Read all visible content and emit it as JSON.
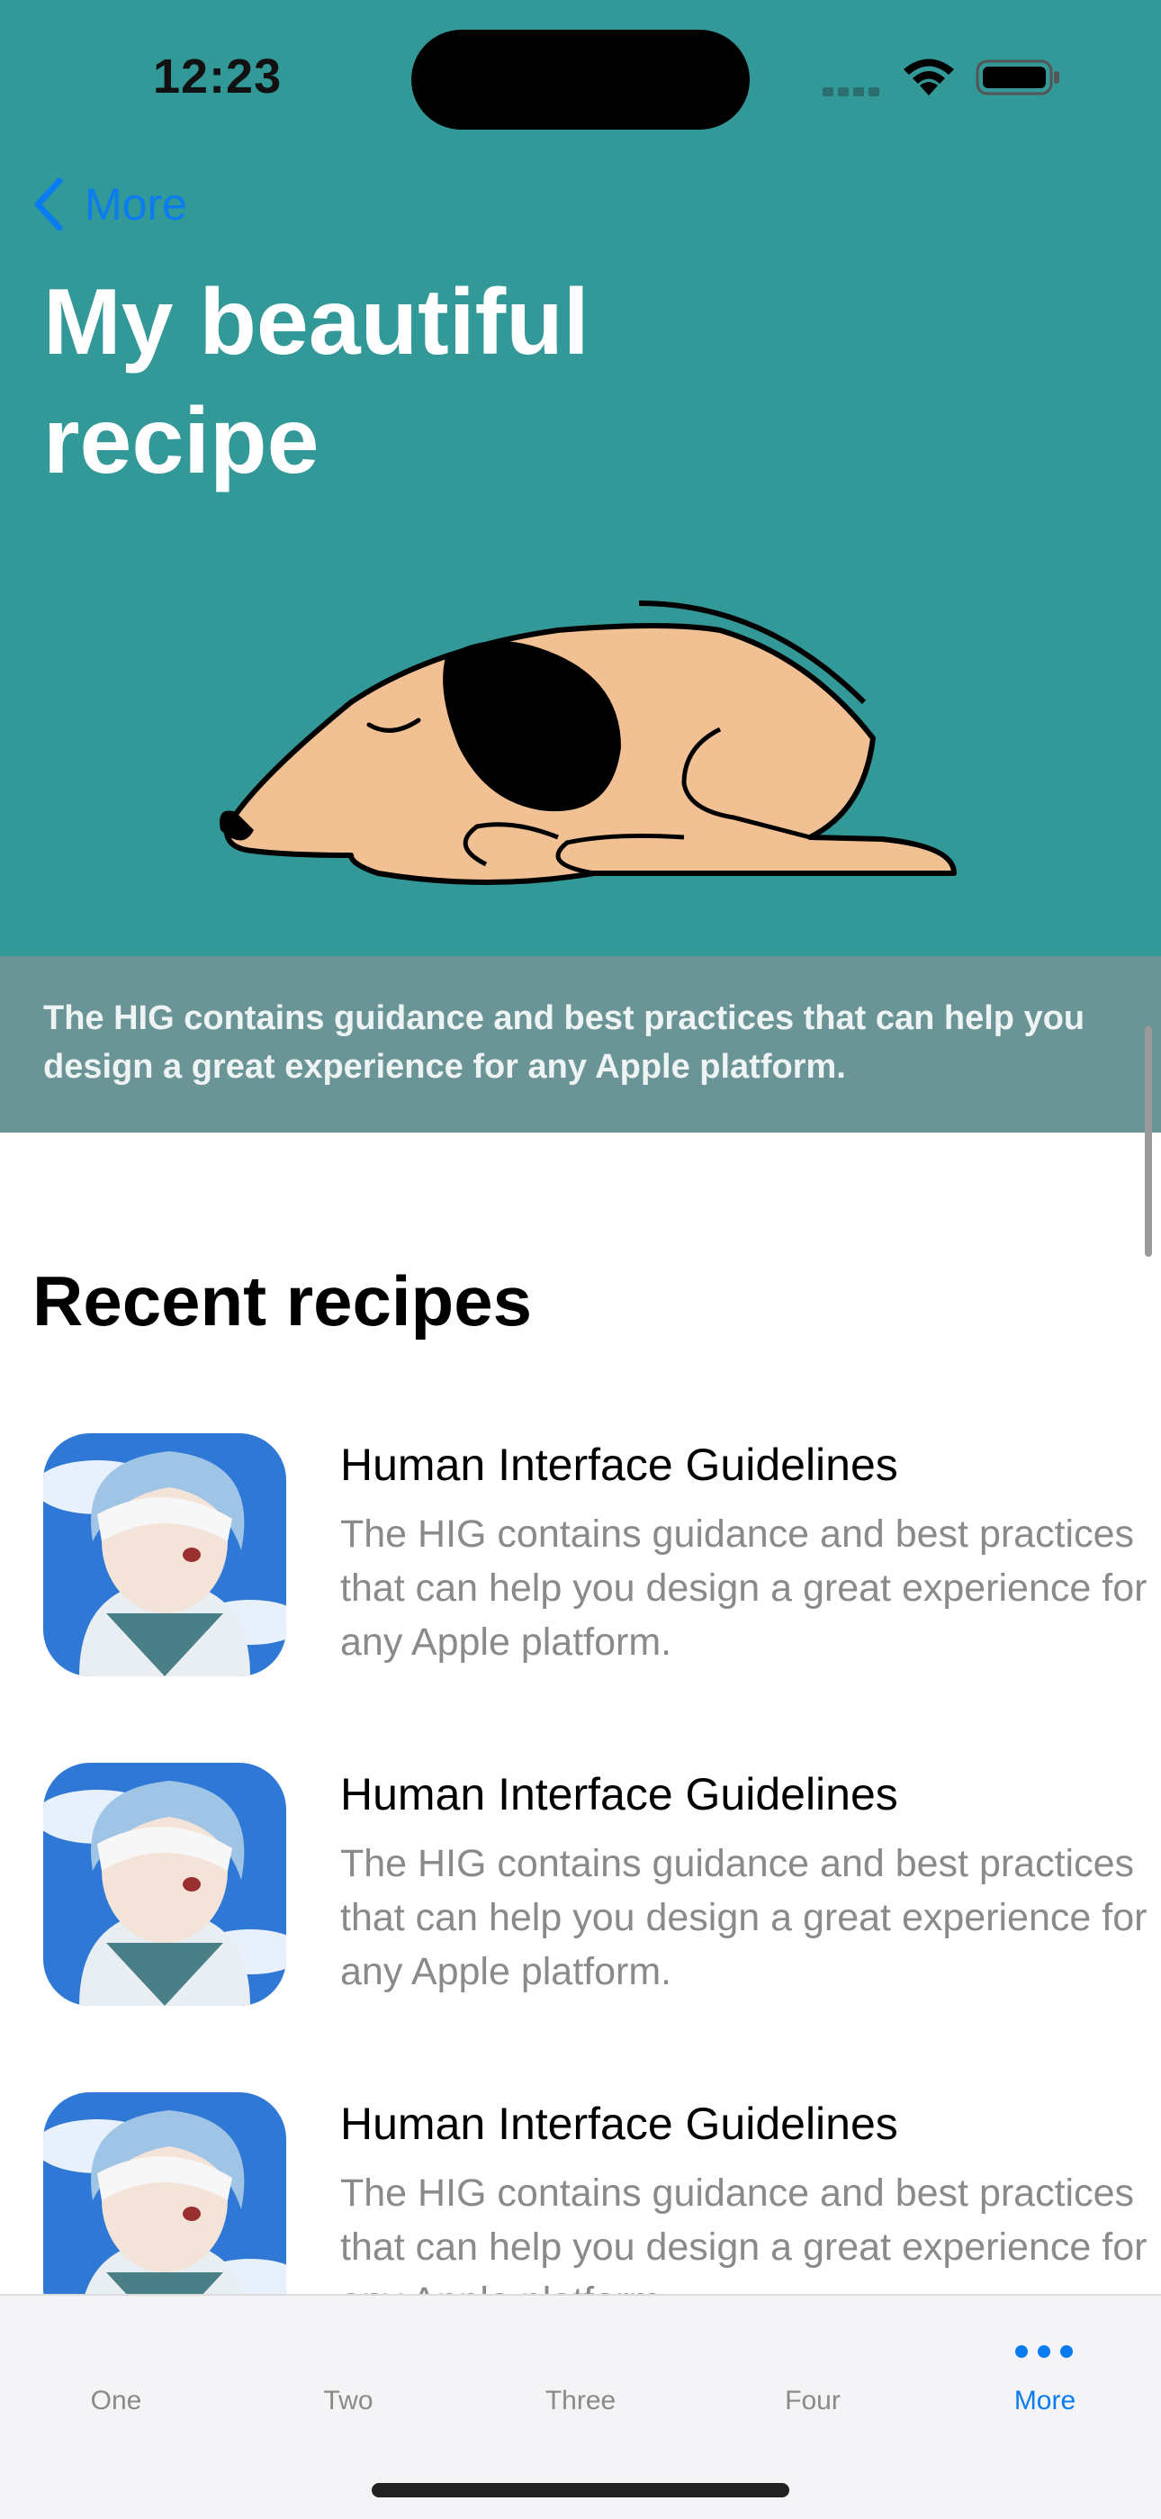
{
  "status_bar": {
    "time": "12:23"
  },
  "nav": {
    "back_label": "More"
  },
  "hero": {
    "title": "My beautiful recipe",
    "caption": "The HIG contains guidance and best practices that can help you design a great experience for any Apple platform."
  },
  "section": {
    "title": "Recent recipes"
  },
  "recipes": [
    {
      "title": "Human Interface Guidelines",
      "description": "The HIG contains guidance and best practices that can help you design a great experience for any Apple platform."
    },
    {
      "title": "Human Interface Guidelines",
      "description": "The HIG contains guidance and best practices that can help you design a great experience for any Apple platform."
    },
    {
      "title": "Human Interface Guidelines",
      "description": "The HIG contains guidance and best practices that can help you design a great experience for any Apple platform."
    }
  ],
  "tabs": [
    {
      "label": "One"
    },
    {
      "label": "Two"
    },
    {
      "label": "Three"
    },
    {
      "label": "Four"
    },
    {
      "label": "More"
    }
  ],
  "colors": {
    "accent": "#0a7cf0",
    "hero_bg": "#339898",
    "caption_band": "#6b9496"
  }
}
